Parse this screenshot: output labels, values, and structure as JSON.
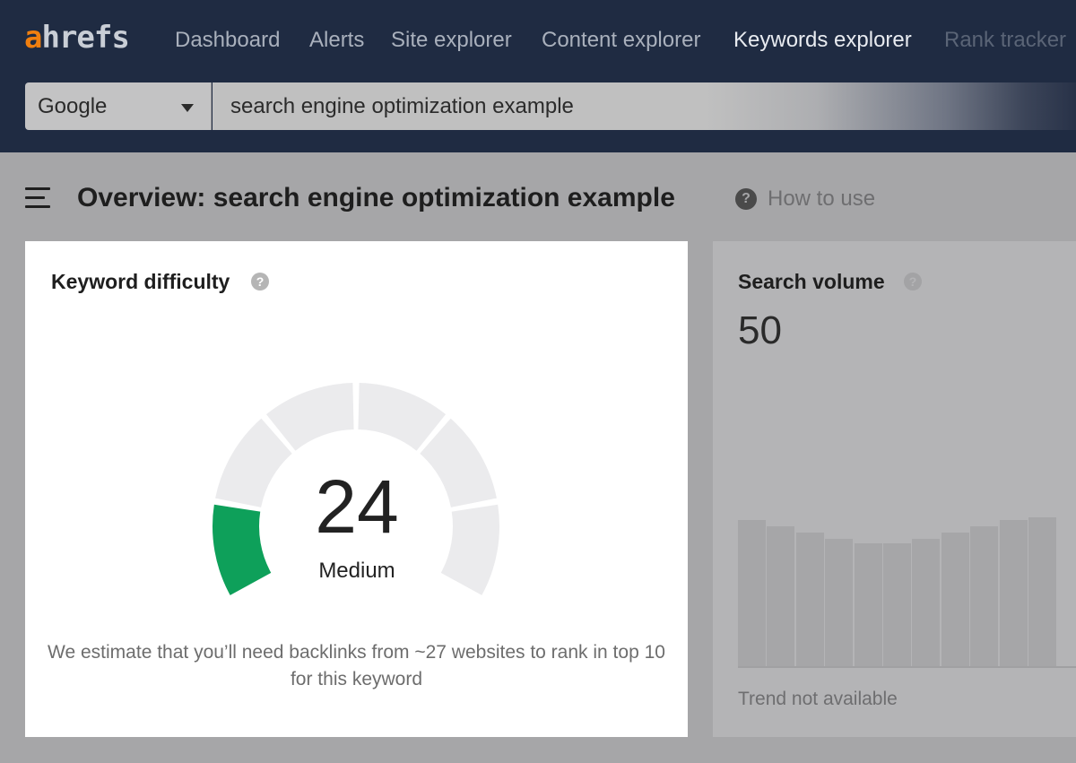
{
  "logo": {
    "accent": "a",
    "rest": "hrefs"
  },
  "nav": {
    "items": [
      {
        "label": "Dashboard"
      },
      {
        "label": "Alerts"
      },
      {
        "label": "Site explorer"
      },
      {
        "label": "Content explorer"
      },
      {
        "label": "Keywords explorer",
        "active": true
      },
      {
        "label": "Rank tracker"
      }
    ]
  },
  "search": {
    "engine": "Google",
    "query": "search engine optimization example"
  },
  "overview": {
    "title": "Overview: search engine optimization example",
    "help_icon": "?",
    "how_to_use": "How to use"
  },
  "keyword_difficulty": {
    "title": "Keyword difficulty",
    "help_icon": "?",
    "value": "24",
    "score": 24,
    "level": "Medium",
    "note": "We estimate that you’ll need backlinks from ~27 websites to rank in top 10 for this keyword",
    "colors": {
      "filled_dark": "#0ea05a",
      "filled_light": "#45ad3f",
      "empty": "#ebebed"
    }
  },
  "search_volume": {
    "title": "Search volume",
    "help_icon": "?",
    "value": "50",
    "trend_note": "Trend not available",
    "trend_bars": [
      0.98,
      0.94,
      0.9,
      0.86,
      0.83,
      0.83,
      0.86,
      0.9,
      0.94,
      0.98,
      1.0
    ]
  },
  "colors": {
    "topbar": "#1f2b42",
    "logo_accent": "#f07f0f",
    "overlay_background": "#a6a6a8"
  }
}
